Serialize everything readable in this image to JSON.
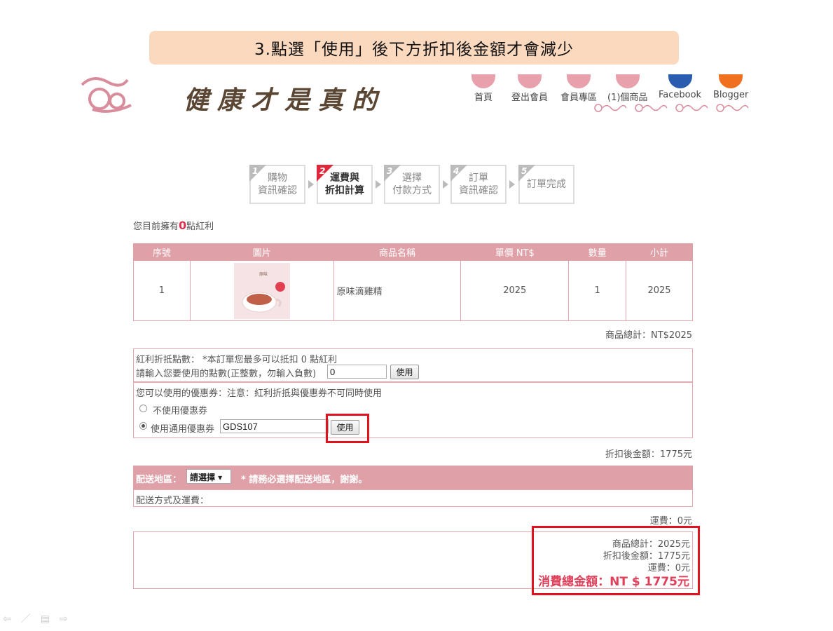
{
  "banner": {
    "text": "3.點選「使用」後下方折扣後金額才會減少"
  },
  "header": {
    "brand": "健康才是真的",
    "nav": [
      {
        "label": "首頁",
        "color": "#e8a0ac"
      },
      {
        "label": "登出會員",
        "color": "#e8a0ac"
      },
      {
        "label": "會員專區",
        "color": "#e8a0ac"
      },
      {
        "label": "(1)個商品",
        "color": "#e8a0ac"
      },
      {
        "label": "Facebook",
        "color": "#2a5db0"
      },
      {
        "label": "Blogger",
        "color": "#f07020"
      }
    ]
  },
  "steps": [
    {
      "num": "1",
      "line1": "購物",
      "line2": "資訊確認",
      "active": false
    },
    {
      "num": "2",
      "line1": "運費與",
      "line2": "折扣計算",
      "active": true
    },
    {
      "num": "3",
      "line1": "選擇",
      "line2": "付款方式",
      "active": false
    },
    {
      "num": "4",
      "line1": "訂單",
      "line2": "資訊確認",
      "active": false
    },
    {
      "num": "5",
      "line1": "訂單完成",
      "line2": "",
      "active": false
    }
  ],
  "points": {
    "prefix": "您目前擁有",
    "value": "0",
    "suffix": "點紅利"
  },
  "cart": {
    "headers": [
      "序號",
      "圖片",
      "商品名稱",
      "單價 NT$",
      "數量",
      "小計"
    ],
    "rows": [
      {
        "index": "1",
        "name": "原味滴雞精",
        "price": "2025",
        "qty": "1",
        "subtotal": "2025"
      }
    ],
    "product_total": "商品總計：NT$2025"
  },
  "bonus": {
    "line1": "紅利折抵點數： *本訂單您最多可以抵扣 0 點紅利",
    "line2": "請輸入您要使用的點數(正整數，勿輸入負數)",
    "input_value": "0",
    "button": "使用"
  },
  "coupon": {
    "title": "您可以使用的優惠券：注意：紅利折抵與優惠券不可同時使用",
    "option_none": "不使用優惠券",
    "option_use": "使用通用優惠券",
    "code": "GDS107",
    "button": "使用"
  },
  "discount_total": "折扣後金額：1775元",
  "shipping": {
    "label": "配送地區：",
    "select": "請選擇 ▾",
    "note": "* 請務必選擇配送地區，謝謝。",
    "method": "配送方式及運費："
  },
  "shipping_fee": "運費：0元",
  "summary": {
    "product": "商品總計：2025元",
    "discount": "折扣後金額：1775元",
    "fee": "運費：0元",
    "grand": "消費總金額：NT $ 1775元"
  },
  "accent": {
    "pink": "#dfa0a8",
    "red": "#e0121e",
    "step_red": "#e0283c",
    "step_gray": "#bbbbbb"
  }
}
